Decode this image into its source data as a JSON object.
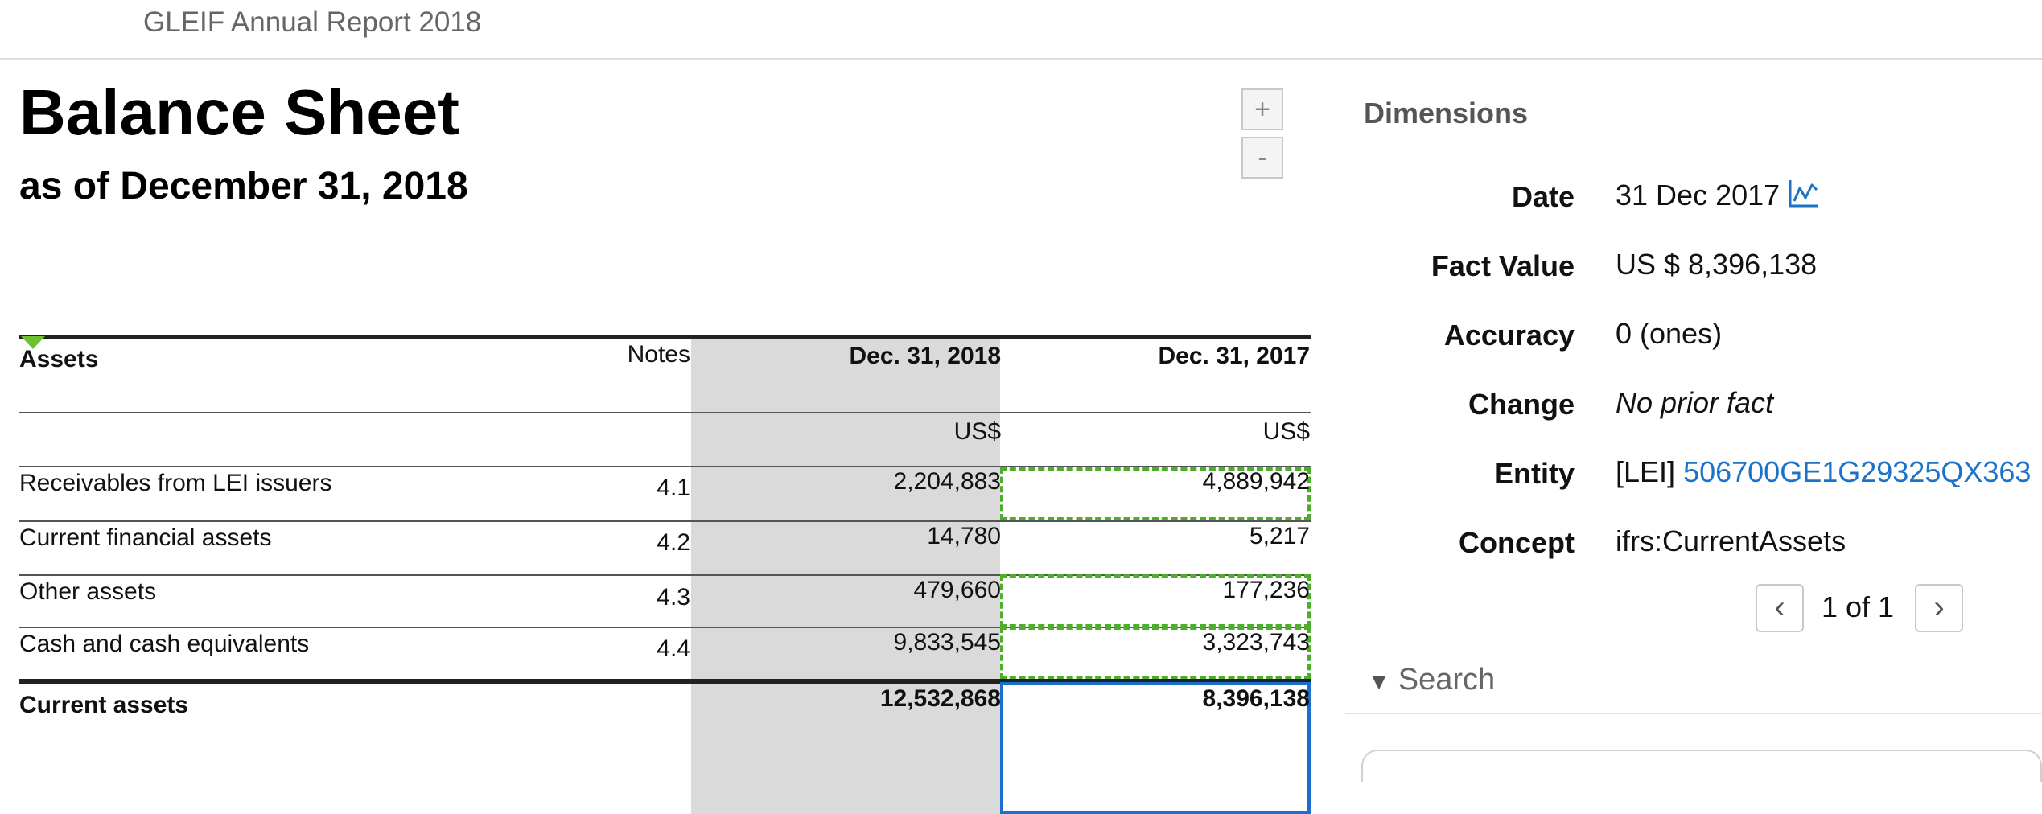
{
  "header": {
    "document_title": "GLEIF Annual Report 2018"
  },
  "statement": {
    "title": "Balance Sheet",
    "subtitle": "as of December 31, 2018",
    "zoom_in_label": "+",
    "zoom_out_label": "-"
  },
  "table": {
    "columns": {
      "label": "Assets",
      "notes": "Notes",
      "col1": "Dec. 31, 2018",
      "col2": "Dec. 31, 2017"
    },
    "currency": {
      "col1": "US$",
      "col2": "US$"
    },
    "rows": [
      {
        "label": "Receivables from LEI issuers",
        "note": "4.1",
        "v2018": "2,204,883",
        "v2017": "4,889,942"
      },
      {
        "label": "Current financial assets",
        "note": "4.2",
        "v2018": "14,780",
        "v2017": "5,217"
      },
      {
        "label": "Other assets",
        "note": "4.3",
        "v2018": "479,660",
        "v2017": "177,236"
      },
      {
        "label": "Cash and cash equivalents",
        "note": "4.4",
        "v2018": "9,833,545",
        "v2017": "3,323,743"
      }
    ],
    "total": {
      "label": "Current assets",
      "v2018": "12,532,868",
      "v2017": "8,396,138"
    }
  },
  "inspector": {
    "title": "Dimensions",
    "fields": {
      "date": {
        "label": "Date",
        "value": "31 Dec 2017"
      },
      "fact_value": {
        "label": "Fact Value",
        "value": "US $ 8,396,138"
      },
      "accuracy": {
        "label": "Accuracy",
        "value": "0 (ones)"
      },
      "change": {
        "label": "Change",
        "value": "No prior fact"
      },
      "entity": {
        "label": "Entity",
        "prefix": "[LEI]",
        "value": "506700GE1G29325QX363"
      },
      "concept": {
        "label": "Concept",
        "value": "ifrs:CurrentAssets"
      }
    },
    "pager": {
      "text": "1 of 1",
      "prev": "‹",
      "next": "›"
    },
    "search": {
      "label": "Search"
    }
  },
  "icons": {
    "chart": "line-chart-icon",
    "triangle": "triangle-down-icon"
  },
  "colors": {
    "link": "#1a73c8",
    "highlight_dashed": "#4cae2a",
    "selected": "#1a6fd1",
    "shade": "#dadada"
  }
}
